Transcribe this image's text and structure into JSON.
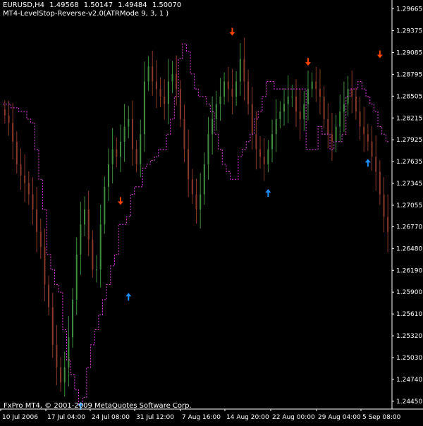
{
  "header": {
    "symbol": "EURUSD,H4",
    "ohlc": [
      "1.49568",
      "1.50147",
      "1.49484",
      "1.50070"
    ],
    "indicator": "MT4-LevelStop-Reverse-v2.0(ATRMode 9, 3, 1 )"
  },
  "footer": {
    "copyright": "FxPro MT4, © 2001-2009 MetaQuotes Software Corp."
  },
  "colors": {
    "background": "#000000",
    "axis": "#ffffff",
    "candle_bull": "#3f8f3f",
    "candle_bear": "#8b3a2a",
    "stop_line": "#e040e0",
    "arrow_up": "#1e90ff",
    "arrow_down": "#ff4500"
  },
  "icons": {
    "buy_signal": "blue-up-arrow-icon",
    "sell_signal": "orange-down-arrow-icon"
  },
  "chart_data": {
    "type": "candlestick",
    "title": "",
    "xlabel": "",
    "ylabel": "",
    "ylim": [
      1.2436,
      1.2975
    ],
    "grid": false,
    "y_ticks": [
      "1.29665",
      "1.29375",
      "1.29085",
      "1.28795",
      "1.28505",
      "1.28215",
      "1.27925",
      "1.27635",
      "1.27345",
      "1.27055",
      "1.26770",
      "1.26480",
      "1.26190",
      "1.25900",
      "1.25610",
      "1.25320",
      "1.25030",
      "1.24740",
      "1.24450"
    ],
    "x_ticks": [
      "10 Jul 2006",
      "17 Jul 04:00",
      "24 Jul 08:00",
      "31 Jul 12:00",
      "7 Aug 16:00",
      "14 Aug 20:00",
      "22 Aug 00:00",
      "29 Aug 04:00",
      "5 Sep 08:00"
    ],
    "series": [
      {
        "name": "close",
        "values": [
          1.2825,
          1.2815,
          1.279,
          1.276,
          1.2745,
          1.2735,
          1.272,
          1.27,
          1.267,
          1.265,
          1.26,
          1.257,
          1.252,
          1.249,
          1.247,
          1.249,
          1.253,
          1.258,
          1.264,
          1.268,
          1.27,
          1.266,
          1.262,
          1.262,
          1.268,
          1.273,
          1.276,
          1.278,
          1.277,
          1.279,
          1.281,
          1.282,
          1.278,
          1.276,
          1.28,
          1.287,
          1.289,
          1.287,
          1.286,
          1.285,
          1.284,
          1.287,
          1.288,
          1.286,
          1.282,
          1.278,
          1.274,
          1.272,
          1.27,
          1.272,
          1.276,
          1.28,
          1.282,
          1.284,
          1.285,
          1.287,
          1.286,
          1.285,
          1.287,
          1.29,
          1.287,
          1.284,
          1.28,
          1.278,
          1.277,
          1.276,
          1.278,
          1.28,
          1.282,
          1.283,
          1.284,
          1.285,
          1.285,
          1.283,
          1.282,
          1.284,
          1.286,
          1.287,
          1.286,
          1.285,
          1.282,
          1.28,
          1.279,
          1.281,
          1.283,
          1.284,
          1.286,
          1.285,
          1.283,
          1.281,
          1.28,
          1.279,
          1.277,
          1.275,
          1.272,
          1.269,
          1.267
        ]
      },
      {
        "name": "level stop",
        "values": [
          1.284,
          1.284,
          1.2835,
          1.2835,
          1.283,
          1.283,
          1.282,
          1.2815,
          1.278,
          1.274,
          1.27,
          1.264,
          1.262,
          1.26,
          1.259,
          1.254,
          1.25,
          1.248,
          1.246,
          1.244,
          1.245,
          1.249,
          1.252,
          1.254,
          1.256,
          1.258,
          1.26,
          1.2625,
          1.264,
          1.268,
          1.268,
          1.269,
          1.272,
          1.273,
          1.273,
          1.2755,
          1.276,
          1.2765,
          1.277,
          1.278,
          1.278,
          1.28,
          1.282,
          1.285,
          1.29,
          1.292,
          1.291,
          1.288,
          1.286,
          1.285,
          1.285,
          1.284,
          1.283,
          1.28,
          1.278,
          1.276,
          1.275,
          1.274,
          1.274,
          1.277,
          1.278,
          1.279,
          1.28,
          1.282,
          1.283,
          1.285,
          1.287,
          1.287,
          1.286,
          1.286,
          1.286,
          1.286,
          1.286,
          1.286,
          1.286,
          1.286,
          1.278,
          1.278,
          1.278,
          1.281,
          1.28,
          1.28,
          1.278,
          1.279,
          1.279,
          1.28,
          1.285,
          1.286,
          1.286,
          1.287,
          1.286,
          1.285,
          1.284,
          1.283,
          1.281,
          1.28,
          1.279
        ]
      }
    ],
    "signals": [
      {
        "type": "buy",
        "bar": 19,
        "price": 1.2445
      },
      {
        "type": "sell",
        "bar": 29,
        "price": 1.2705
      },
      {
        "type": "buy",
        "bar": 31,
        "price": 1.259
      },
      {
        "type": "sell",
        "bar": 57,
        "price": 1.293
      },
      {
        "type": "buy",
        "bar": 66,
        "price": 1.2728
      },
      {
        "type": "sell",
        "bar": 76,
        "price": 1.289
      },
      {
        "type": "buy",
        "bar": 91,
        "price": 1.2768
      },
      {
        "type": "sell",
        "bar": 94,
        "price": 1.29
      }
    ]
  }
}
